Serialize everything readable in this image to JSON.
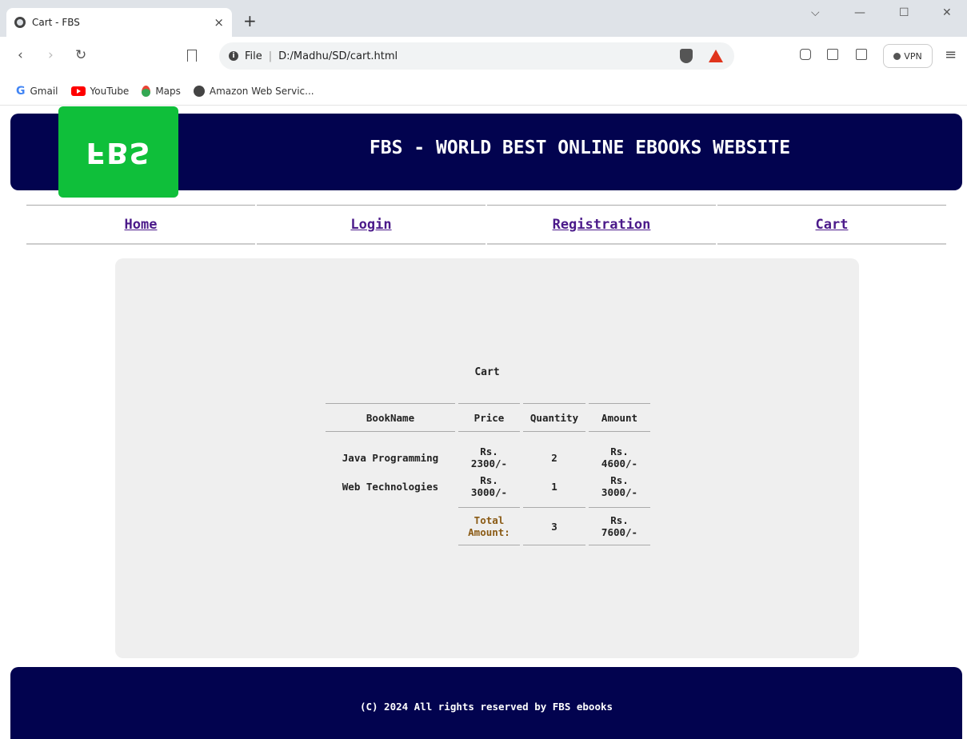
{
  "browser": {
    "tab_title": "Cart - FBS",
    "tab_close": "×",
    "new_tab": "+",
    "url_prefix": "File",
    "url": "D:/Madhu/SD/cart.html",
    "vpn_label": "VPN",
    "bookmarks": [
      {
        "label": "Gmail",
        "icon": "gmail-icon"
      },
      {
        "label": "YouTube",
        "icon": "youtube-icon"
      },
      {
        "label": "Maps",
        "icon": "maps-icon"
      },
      {
        "label": "Amazon Web Servic...",
        "icon": "globe-icon"
      }
    ]
  },
  "header": {
    "logo_text": "FBS",
    "title": "FBS - WORLD BEST ONLINE EBOOKS WEBSITE"
  },
  "nav": {
    "items": [
      "Home",
      "Login",
      "Registration",
      "Cart"
    ]
  },
  "cart": {
    "caption": "Cart",
    "columns": [
      "BookName",
      "Price",
      "Quantity",
      "Amount"
    ],
    "rows": [
      {
        "book": "Java Programming",
        "price_1": "Rs.",
        "price_2": "2300/-",
        "qty": "2",
        "amount_1": "Rs.",
        "amount_2": "4600/-"
      },
      {
        "book": "Web Technologies",
        "price_1": "Rs.",
        "price_2": "3000/-",
        "qty": "1",
        "amount_1": "Rs.",
        "amount_2": "3000/-"
      }
    ],
    "total": {
      "label_1": "Total",
      "label_2": "Amount:",
      "qty": "3",
      "amount_1": "Rs.",
      "amount_2": "7600/-"
    }
  },
  "footer": {
    "text": "(C) 2024 All rights reserved by FBS ebooks"
  },
  "colors": {
    "header_bg": "#02034f",
    "logo_bg": "#0fbf3a",
    "nav_link": "#4b1a8a",
    "total_label": "#8a5a14",
    "content_bg": "#efefef"
  }
}
